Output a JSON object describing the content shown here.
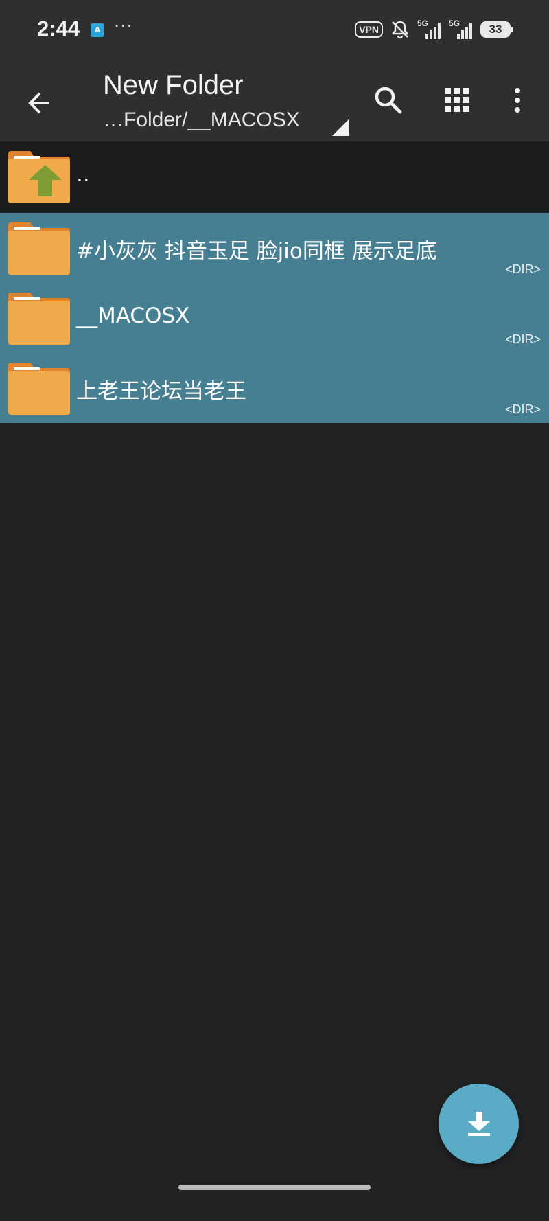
{
  "status_bar": {
    "time": "2:44",
    "app_icon_text": "A",
    "more": "···",
    "vpn": "VPN",
    "signal_1": "5G",
    "signal_2": "5G",
    "battery": "33"
  },
  "app_bar": {
    "title": "New Folder",
    "subtitle": "…Folder/__MACOSX",
    "icons": {
      "back": "arrow-back-icon",
      "search": "search-icon",
      "view": "grid-view-icon",
      "more": "more-vertical-icon"
    }
  },
  "file_list": {
    "parent": {
      "name": ".."
    },
    "items": [
      {
        "name": "#小灰灰 抖音玉足 脸jio同框 展示足底",
        "meta": "<DIR>"
      },
      {
        "name": "__MACOSX",
        "meta": "<DIR>"
      },
      {
        "name": "上老王论坛当老王",
        "meta": "<DIR>"
      }
    ]
  },
  "fab": {
    "icon": "download-icon"
  },
  "colors": {
    "selected_row": "#477f92",
    "background": "#212224",
    "toolbar": "#2f2f31",
    "folder": "#f1aa4a",
    "folder_tab": "#e0852e",
    "up_arrow": "#7e9b34",
    "fab": "#5aabc5"
  }
}
